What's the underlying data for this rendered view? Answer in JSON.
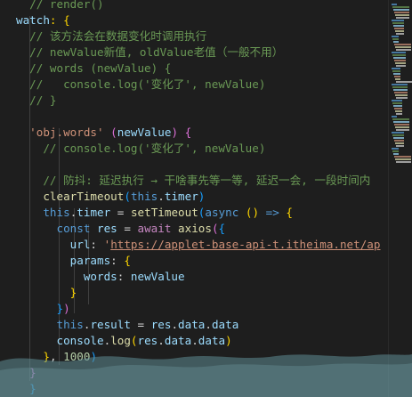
{
  "code_lines": [
    [
      {
        "t": "  ",
        "c": ""
      },
      {
        "t": "// ",
        "c": "t-com"
      },
      {
        "t": "ren",
        "c": "t-com"
      },
      {
        "t": "der()",
        "c": "t-com"
      }
    ],
    [
      {
        "t": "watch",
        "c": "t-var"
      },
      {
        "t": ": {",
        "c": "t-b1"
      }
    ],
    [
      {
        "t": "  // 该方法会在数据变化时调用执行",
        "c": "t-com"
      }
    ],
    [
      {
        "t": "  // newValue新值, oldValue老值（一般不用）",
        "c": "t-com"
      }
    ],
    [
      {
        "t": "  // words (newValue) {",
        "c": "t-com"
      }
    ],
    [
      {
        "t": "  //   console.log('变化了', newValue)",
        "c": "t-com"
      }
    ],
    [
      {
        "t": "  // }",
        "c": "t-com"
      }
    ],
    [
      {
        "t": "",
        "c": ""
      }
    ],
    [
      {
        "t": "  ",
        "c": ""
      },
      {
        "t": "'obj.words'",
        "c": "t-str"
      },
      {
        "t": " ",
        "c": ""
      },
      {
        "t": "(",
        "c": "t-b2"
      },
      {
        "t": "newValue",
        "c": "t-var"
      },
      {
        "t": ")",
        "c": "t-b2"
      },
      {
        "t": " ",
        "c": ""
      },
      {
        "t": "{",
        "c": "t-b2"
      }
    ],
    [
      {
        "t": "    // console.log('变化了', newValue)",
        "c": "t-com"
      }
    ],
    [
      {
        "t": "",
        "c": ""
      }
    ],
    [
      {
        "t": "    // 防抖: 延迟执行 → 干啥事先等一等, 延迟一会, 一段时间内",
        "c": "t-com"
      }
    ],
    [
      {
        "t": "    ",
        "c": ""
      },
      {
        "t": "clearTimeout",
        "c": "t-fn"
      },
      {
        "t": "(",
        "c": "t-b3"
      },
      {
        "t": "this",
        "c": "t-kw"
      },
      {
        "t": ".",
        "c": ""
      },
      {
        "t": "timer",
        "c": "t-var"
      },
      {
        "t": ")",
        "c": "t-b3"
      }
    ],
    [
      {
        "t": "    ",
        "c": ""
      },
      {
        "t": "this",
        "c": "t-kw"
      },
      {
        "t": ".",
        "c": ""
      },
      {
        "t": "timer",
        "c": "t-var"
      },
      {
        "t": " = ",
        "c": ""
      },
      {
        "t": "setTimeout",
        "c": "t-fn"
      },
      {
        "t": "(",
        "c": "t-b3"
      },
      {
        "t": "async",
        "c": "t-kw"
      },
      {
        "t": " ",
        "c": ""
      },
      {
        "t": "()",
        "c": "t-b1"
      },
      {
        "t": " ",
        "c": ""
      },
      {
        "t": "=>",
        "c": "t-kw"
      },
      {
        "t": " ",
        "c": ""
      },
      {
        "t": "{",
        "c": "t-b1"
      }
    ],
    [
      {
        "t": "      ",
        "c": ""
      },
      {
        "t": "const",
        "c": "t-kw"
      },
      {
        "t": " ",
        "c": ""
      },
      {
        "t": "res",
        "c": "t-var"
      },
      {
        "t": " = ",
        "c": ""
      },
      {
        "t": "await",
        "c": "t-ctl"
      },
      {
        "t": " ",
        "c": ""
      },
      {
        "t": "axios",
        "c": "t-fn"
      },
      {
        "t": "(",
        "c": "t-b2"
      },
      {
        "t": "{",
        "c": "t-b3"
      }
    ],
    [
      {
        "t": "        ",
        "c": ""
      },
      {
        "t": "url",
        "c": "t-var"
      },
      {
        "t": ": ",
        "c": ""
      },
      {
        "t": "'",
        "c": "t-str"
      },
      {
        "t": "https://applet-base-api-t.itheima.net/ap",
        "c": "t-link"
      }
    ],
    [
      {
        "t": "        ",
        "c": ""
      },
      {
        "t": "params",
        "c": "t-var"
      },
      {
        "t": ": ",
        "c": ""
      },
      {
        "t": "{",
        "c": "t-b1"
      }
    ],
    [
      {
        "t": "          ",
        "c": ""
      },
      {
        "t": "words",
        "c": "t-var"
      },
      {
        "t": ": ",
        "c": ""
      },
      {
        "t": "newValue",
        "c": "t-var"
      }
    ],
    [
      {
        "t": "        ",
        "c": ""
      },
      {
        "t": "}",
        "c": "t-b1"
      }
    ],
    [
      {
        "t": "      ",
        "c": ""
      },
      {
        "t": "}",
        "c": "t-b3"
      },
      {
        "t": ")",
        "c": "t-b2"
      }
    ],
    [
      {
        "t": "      ",
        "c": ""
      },
      {
        "t": "this",
        "c": "t-kw"
      },
      {
        "t": ".",
        "c": ""
      },
      {
        "t": "result",
        "c": "t-var"
      },
      {
        "t": " = ",
        "c": ""
      },
      {
        "t": "res",
        "c": "t-var"
      },
      {
        "t": ".",
        "c": ""
      },
      {
        "t": "data",
        "c": "t-var"
      },
      {
        "t": ".",
        "c": ""
      },
      {
        "t": "data",
        "c": "t-var"
      }
    ],
    [
      {
        "t": "      ",
        "c": ""
      },
      {
        "t": "console",
        "c": "t-var"
      },
      {
        "t": ".",
        "c": ""
      },
      {
        "t": "log",
        "c": "t-fn"
      },
      {
        "t": "(",
        "c": "t-b1"
      },
      {
        "t": "res",
        "c": "t-var"
      },
      {
        "t": ".",
        "c": ""
      },
      {
        "t": "data",
        "c": "t-var"
      },
      {
        "t": ".",
        "c": ""
      },
      {
        "t": "data",
        "c": "t-var"
      },
      {
        "t": ")",
        "c": "t-b1"
      }
    ],
    [
      {
        "t": "    ",
        "c": ""
      },
      {
        "t": "}",
        "c": "t-b1"
      },
      {
        "t": ", ",
        "c": ""
      },
      {
        "t": "1000",
        "c": "t-num"
      },
      {
        "t": ")",
        "c": "t-b3"
      }
    ],
    [
      {
        "t": "  ",
        "c": ""
      },
      {
        "t": "}",
        "c": "t-b2"
      }
    ],
    [
      {
        "t": "  ",
        "c": ""
      },
      {
        "t": "}",
        "c": "t-b3"
      }
    ],
    [
      {
        "t": "})",
        "c": "t-b1"
      }
    ]
  ],
  "colors": {
    "background": "#1e1e1e",
    "comment": "#6a9955",
    "keyword": "#569cd6",
    "string": "#ce9178",
    "function": "#dcdcaa",
    "variable": "#9cdcfe",
    "number": "#b5cea8"
  },
  "minimap": {
    "icon": "minimap-preview"
  }
}
